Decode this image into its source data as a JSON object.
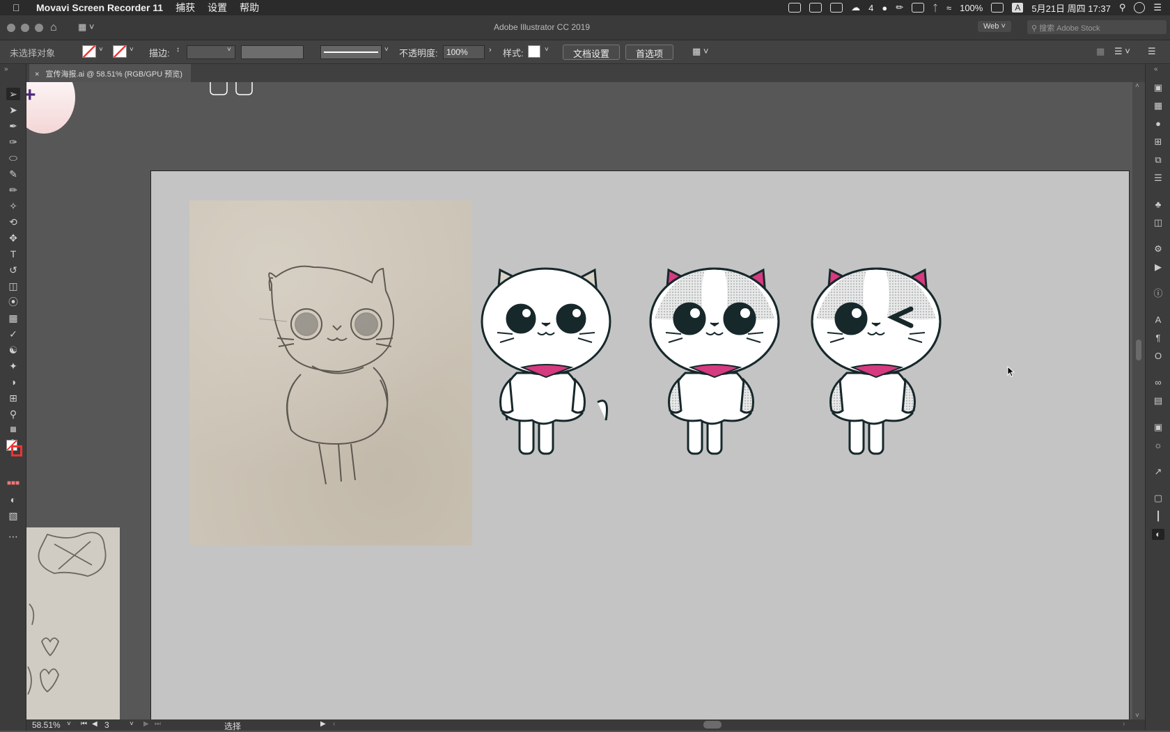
{
  "menubar": {
    "app_name": "Movavi Screen Recorder 11",
    "items": [
      "捕获",
      "设置",
      "帮助"
    ],
    "status": {
      "wechat_count": "4",
      "battery": "100%",
      "input_method": "A",
      "datetime": "5月21日 周四  17:37"
    }
  },
  "window": {
    "title": "Adobe Illustrator CC 2019",
    "workspace_label": "Web",
    "search_placeholder": "搜索 Adobe Stock"
  },
  "control_bar": {
    "selection_label": "未选择对象",
    "stroke_label": "描边:",
    "opacity_label": "不透明度:",
    "opacity_value": "100%",
    "style_label": "样式:",
    "doc_setup_button": "文档设置",
    "preferences_button": "首选项"
  },
  "document_tab": {
    "close": "×",
    "title": "宣传海报.ai @ 58.51% (RGB/GPU 预览)"
  },
  "statusbar": {
    "zoom": "58.51%",
    "artboard_number": "3",
    "tool_status": "选择"
  },
  "colors": {
    "cat_outline": "#17282b",
    "cat_pink": "#d63a7f",
    "cat_ear_beige": "#d9d4c6",
    "artboard_bg": "#c4c4c4"
  }
}
